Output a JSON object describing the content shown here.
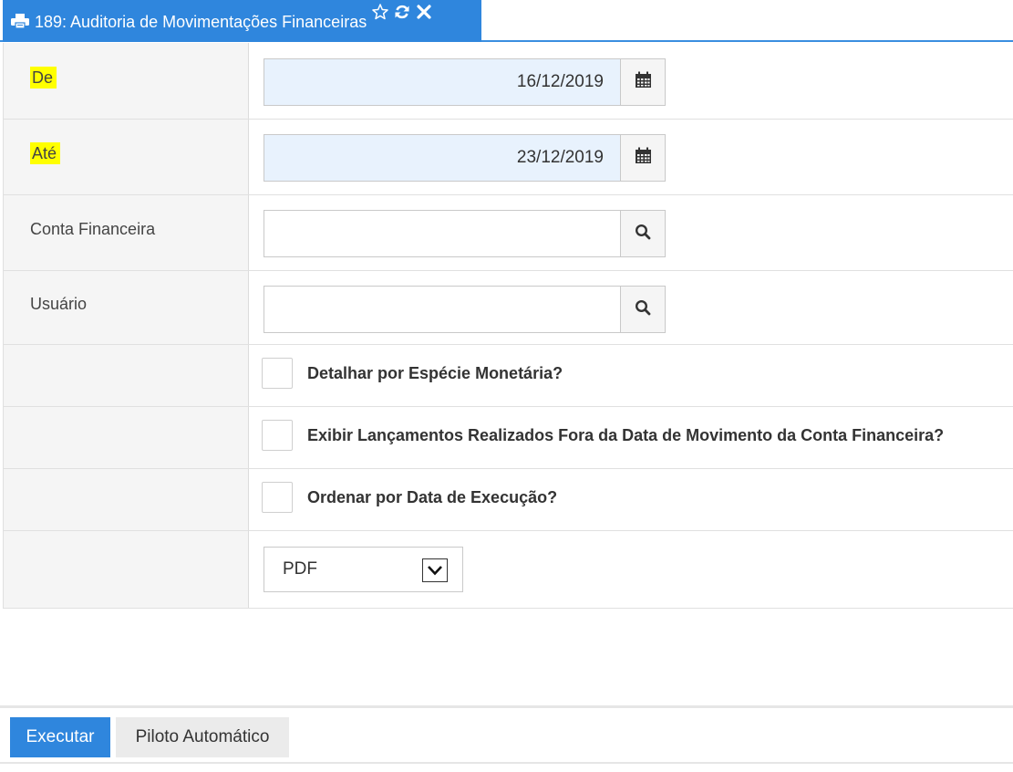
{
  "tab": {
    "title": "189: Auditoria de Movimentações Financeiras",
    "icons": [
      "printer-icon",
      "star-icon",
      "refresh-icon",
      "close-icon"
    ]
  },
  "form": {
    "de": {
      "label": "De",
      "value": "16/12/2019",
      "icon": "calendar-icon"
    },
    "ate": {
      "label": "Até",
      "value": "23/12/2019",
      "icon": "calendar-icon"
    },
    "conta": {
      "label": "Conta Financeira",
      "value": "",
      "icon": "search-icon"
    },
    "usuario": {
      "label": "Usuário",
      "value": "",
      "icon": "search-icon"
    },
    "checkboxes": [
      {
        "label": "Detalhar por Espécie Monetária?",
        "checked": false
      },
      {
        "label": "Exibir Lançamentos Realizados Fora da Data de Movimento da Conta Financeira?",
        "checked": false
      },
      {
        "label": "Ordenar por Data de Execução?",
        "checked": false
      }
    ],
    "format": {
      "selected": "PDF"
    }
  },
  "toolbar": {
    "execute_label": "Executar",
    "autopilot_label": "Piloto Automático"
  },
  "colors": {
    "accent": "#2f86dd",
    "highlight": "#ffff00",
    "date_field_bg": "#e8f2fd"
  }
}
